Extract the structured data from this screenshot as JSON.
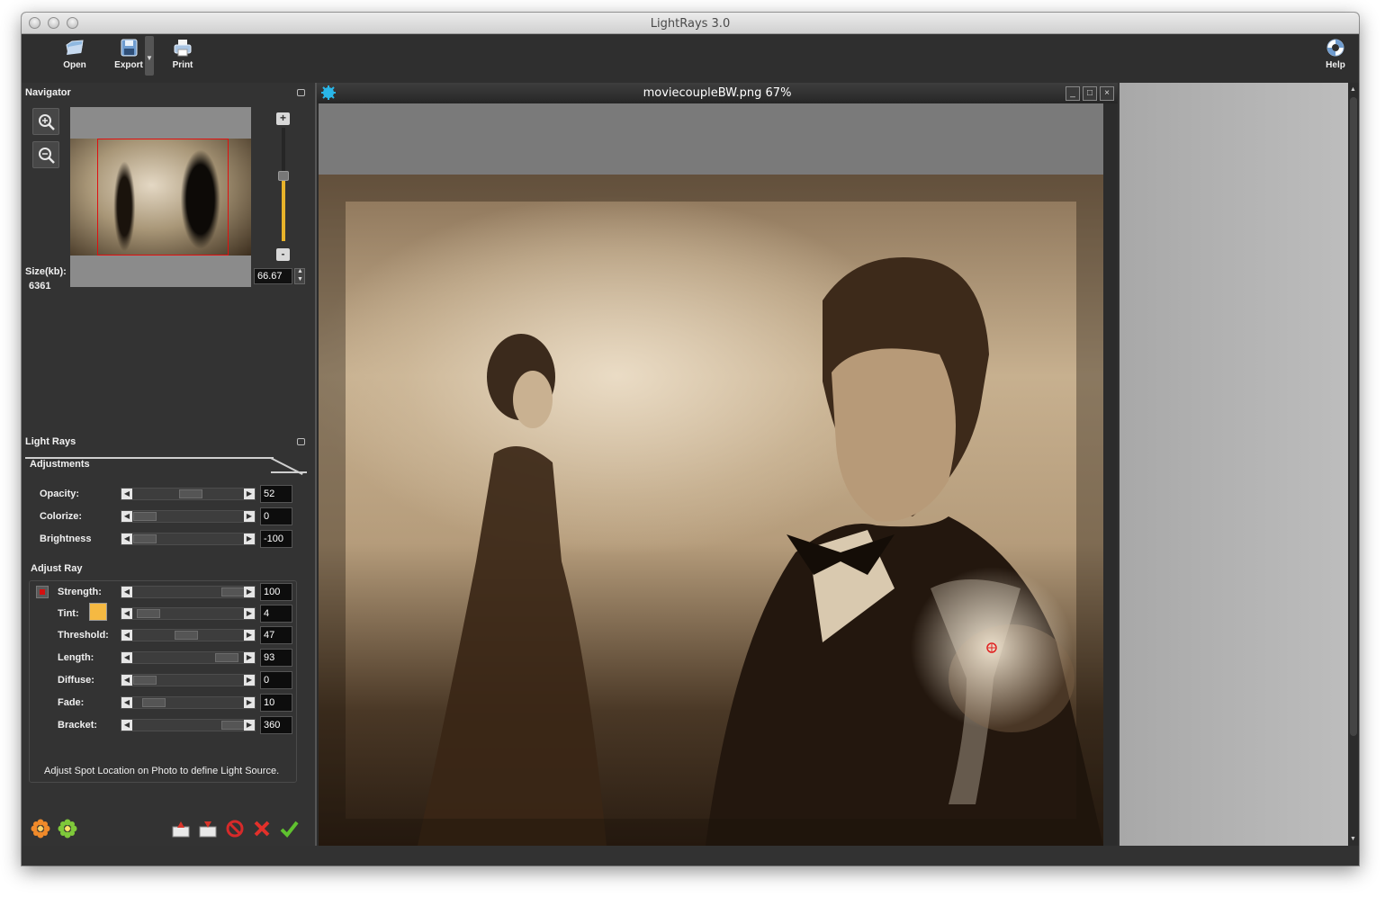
{
  "window": {
    "title": "LightRays 3.0"
  },
  "toolbar": {
    "open_label": "Open",
    "export_label": "Export",
    "print_label": "Print",
    "help_label": "Help"
  },
  "navigator": {
    "title": "Navigator",
    "size_label": "Size(kb):",
    "size_value": "6361",
    "zoom_value": "66.67",
    "zoom_plus": "+",
    "zoom_minus": "-"
  },
  "lightrays": {
    "title": "Light Rays",
    "tab_label": "Adjustments",
    "adjustments": [
      {
        "label": "Opacity:",
        "value": "52",
        "level": 0.52
      },
      {
        "label": "Colorize:",
        "value": "0",
        "level": 0.0
      },
      {
        "label": "Brightness",
        "value": "-100",
        "level": 0.0
      }
    ],
    "adjust_ray_title": "Adjust Ray",
    "ray": [
      {
        "label": "Strength:",
        "value": "100",
        "level": 1.0
      },
      {
        "label": "Tint:",
        "value": "4",
        "level": 0.04
      },
      {
        "label": "Threshold:",
        "value": "47",
        "level": 0.47
      },
      {
        "label": "Length:",
        "value": "93",
        "level": 0.93
      },
      {
        "label": "Diffuse:",
        "value": "0",
        "level": 0.0
      },
      {
        "label": "Fade:",
        "value": "10",
        "level": 0.1
      },
      {
        "label": "Bracket:",
        "value": "360",
        "level": 1.0
      }
    ],
    "tint_color": "#f5b942",
    "hint": "Adjust Spot Location on Photo to define Light Source."
  },
  "document": {
    "title": "moviecoupleBW.png 67%",
    "minimize": "_",
    "maximize": "□",
    "close": "×"
  },
  "colors": {
    "accent": "#e8b32a",
    "selection_rect": "#e01010",
    "panel_bg": "#333333"
  }
}
